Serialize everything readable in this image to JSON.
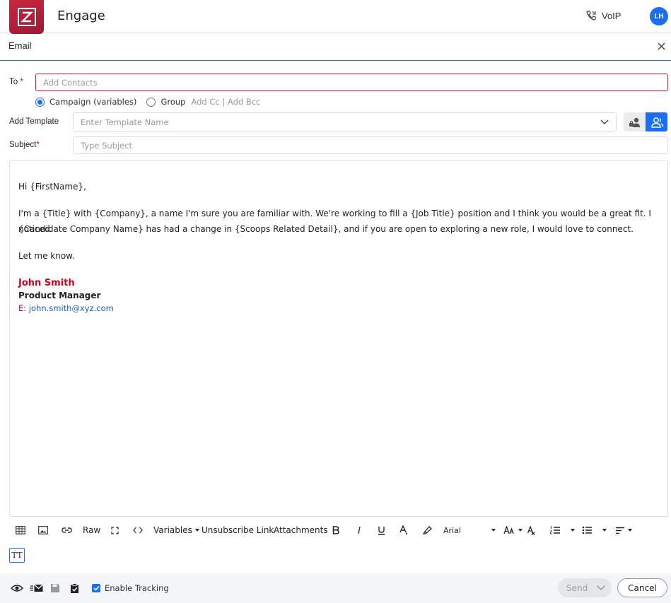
{
  "app": {
    "title": "Engage",
    "voip_label": "VoIP",
    "avatar_initials": "LH"
  },
  "panel": {
    "title": "Email"
  },
  "form": {
    "to_label": "To",
    "required_mark": "*",
    "to_placeholder": "Add Contacts",
    "radio_campaign": "Campaign (variables)",
    "radio_group": "Group",
    "add_cc_bcc": "Add Cc | Add Bcc",
    "template_label": "Add Template",
    "template_placeholder": "Enter Template Name",
    "subject_label": "Subject",
    "subject_placeholder": "Type Subject"
  },
  "body": {
    "greeting": "Hi {FirstName},",
    "paragraph_line1": "I'm a {Title} with {Company}, a name I'm sure you are familiar with. We're working to fill a {Job Title} position and I think you would be a great fit. I noticed",
    "paragraph_line2": "{Candidate Company Name} has had a change in {Scoops Related Detail}, and if you are open to exploring a new role, I would love to connect.",
    "closing": "Let me know.",
    "sig_name": "John Smith",
    "sig_title": "Product Manager",
    "sig_email_prefix": "E:",
    "sig_email": "john.smith@xyz.com"
  },
  "toolbar": {
    "raw": "Raw",
    "variables": "Variables",
    "unsubscribe": "Unsubscribe Link",
    "attachments": "Attachments",
    "font": "Arial",
    "tt": "TT"
  },
  "footer": {
    "tracking": "Enable Tracking",
    "send": "Send",
    "cancel": "Cancel"
  },
  "colors": {
    "brand": "#b51c38",
    "accent": "#1a6ef5",
    "signature_red": "#d0021b"
  }
}
